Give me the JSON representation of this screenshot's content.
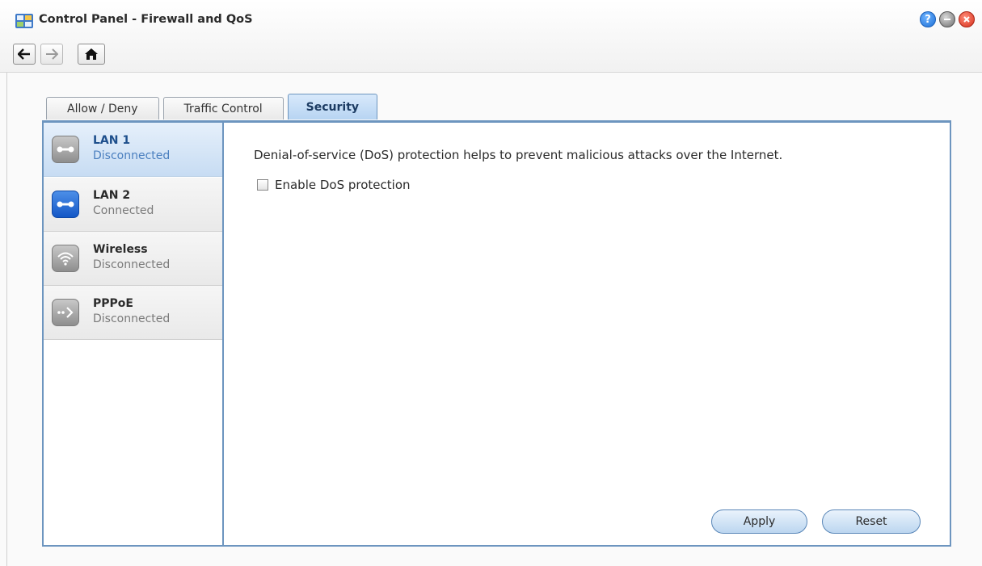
{
  "window": {
    "title": "Control Panel - Firewall and QoS"
  },
  "tabs": [
    {
      "label": "Allow / Deny",
      "active": false
    },
    {
      "label": "Traffic Control",
      "active": false
    },
    {
      "label": "Security",
      "active": true
    }
  ],
  "sidebar": {
    "items": [
      {
        "name": "LAN 1",
        "status": "Disconnected",
        "icon": "ethernet-icon",
        "active": true
      },
      {
        "name": "LAN 2",
        "status": "Connected",
        "icon": "ethernet-icon",
        "active": false
      },
      {
        "name": "Wireless",
        "status": "Disconnected",
        "icon": "wifi-icon",
        "active": false
      },
      {
        "name": "PPPoE",
        "status": "Disconnected",
        "icon": "pppoe-icon",
        "active": false
      }
    ]
  },
  "content": {
    "description": "Denial-of-service (DoS) protection helps to prevent malicious attacks over the Internet.",
    "dos_checkbox_label": "Enable DoS protection",
    "dos_checked": false,
    "apply_label": "Apply",
    "reset_label": "Reset"
  },
  "colors": {
    "accent": "#6d95bf",
    "active_tab": "#b7d4f2",
    "connected_icon": "#1457c6"
  }
}
